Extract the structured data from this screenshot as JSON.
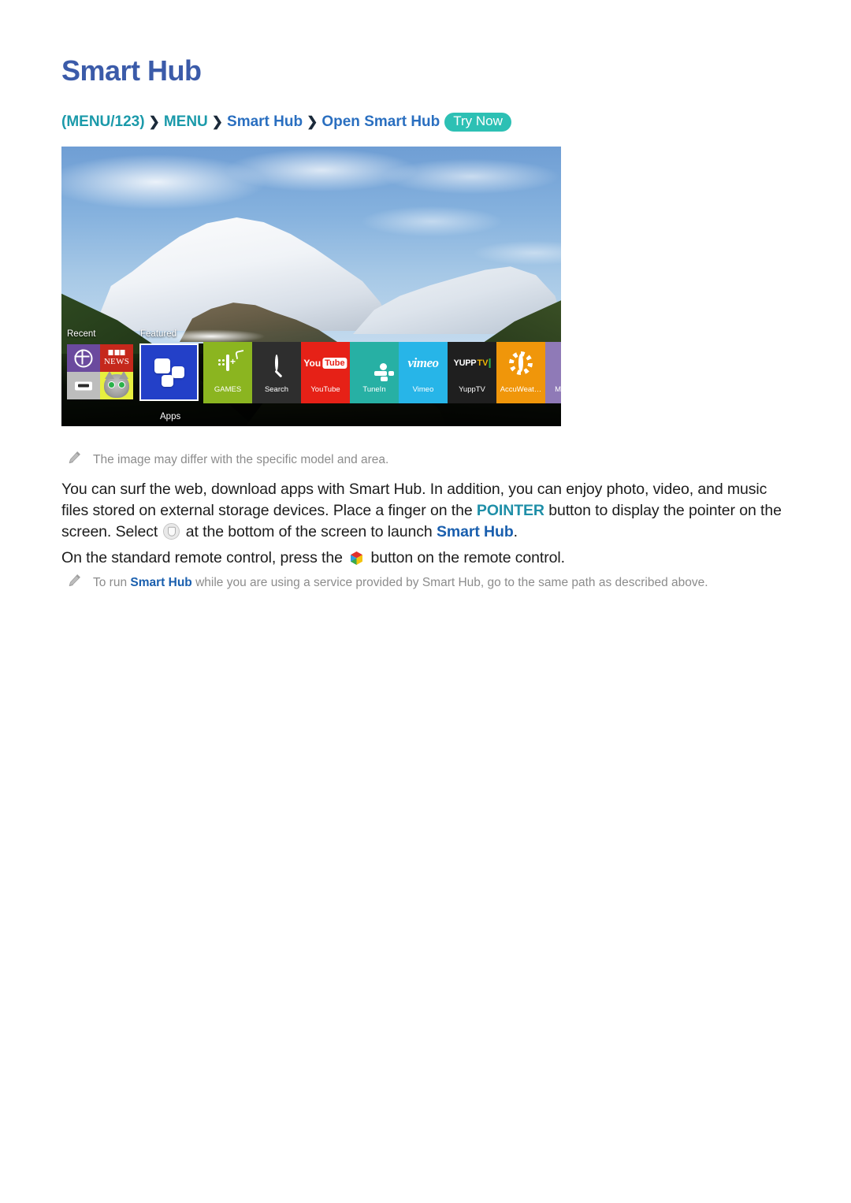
{
  "page": {
    "title": "Smart Hub"
  },
  "breadcrumb": {
    "open_paren": "(",
    "item1": "MENU/123",
    "close_paren": ")",
    "sep": "❯",
    "item2": "MENU",
    "item3": "Smart Hub",
    "item4": "Open Smart Hub",
    "try_now": "Try Now"
  },
  "tv_screen": {
    "recent_label": "Recent",
    "featured_label": "Featured",
    "apps_label": "Apps",
    "recent_tiles": [
      {
        "name": "web-browser",
        "icon": "globe-icon",
        "color": "#6b4a9e"
      },
      {
        "name": "bbc-news",
        "icon": "bbc-news-icon",
        "text": "NEWS",
        "color": "#c5281c"
      },
      {
        "name": "hdmi-source",
        "icon": "hdmi-icon",
        "color": "#bdbdbd"
      },
      {
        "name": "talking-tom",
        "icon": "cat-icon",
        "color": "#e7ef3f"
      }
    ],
    "apps_tile": {
      "label": "Apps",
      "icon": "apps-grid-icon",
      "color": "#2340c8",
      "selected": true
    },
    "app_tiles": [
      {
        "label": "GAMES",
        "icon": "gamepad-icon",
        "color": "#8bb520"
      },
      {
        "label": "Search",
        "icon": "magnifier-icon",
        "color": "#2e2e2e"
      },
      {
        "label": "YouTube",
        "icon": "youtube-icon",
        "color": "#e62117",
        "logo_word": "You",
        "logo_box": "Tube"
      },
      {
        "label": "TuneIn",
        "icon": "tunein-icon",
        "color": "#27b0a4"
      },
      {
        "label": "Vimeo",
        "icon": "vimeo-icon",
        "color": "#27b5e8",
        "logo_word": "vimeo"
      },
      {
        "label": "YuppTV",
        "icon": "yupptv-icon",
        "color": "#1f1f1f",
        "logo_word": "YUPP",
        "logo_box": "TV"
      },
      {
        "label": "AccuWeat…",
        "icon": "sun-icon",
        "color": "#f0960a"
      },
      {
        "label": "MY CON",
        "icon": "folder-icon",
        "color": "#8f7ab7"
      }
    ]
  },
  "notes": {
    "note1": "The image may differ with the specific model and area.",
    "note2_prefix": "To run ",
    "note2_link": "Smart Hub",
    "note2_suffix": " while you are using a service provided by Smart Hub, go to the same path as described above."
  },
  "paragraphs": {
    "p1_a": "You can surf the web, download apps with Smart Hub. In addition, you can enjoy photo, video, and music files stored on external storage devices. Place a finger on the ",
    "p1_pointer": "POINTER",
    "p1_b": " button to display the pointer on the screen. Select ",
    "p1_c": " at the bottom of the screen to launch ",
    "p1_smarthub": "Smart Hub",
    "p1_d": ".",
    "p2_a": "On the standard remote control, press the ",
    "p2_b": " button on the remote control."
  },
  "colors": {
    "title": "#3b5ba9",
    "breadcrumb_teal": "#1b9aaa",
    "breadcrumb_blue": "#2a6fc0",
    "try_now_bg": "#2dc0b4",
    "pointer_highlight": "#1f8fa8",
    "smart_hub_link": "#1a5fae",
    "note_text": "#8c8c8c",
    "body_text": "#1c1c1c"
  }
}
